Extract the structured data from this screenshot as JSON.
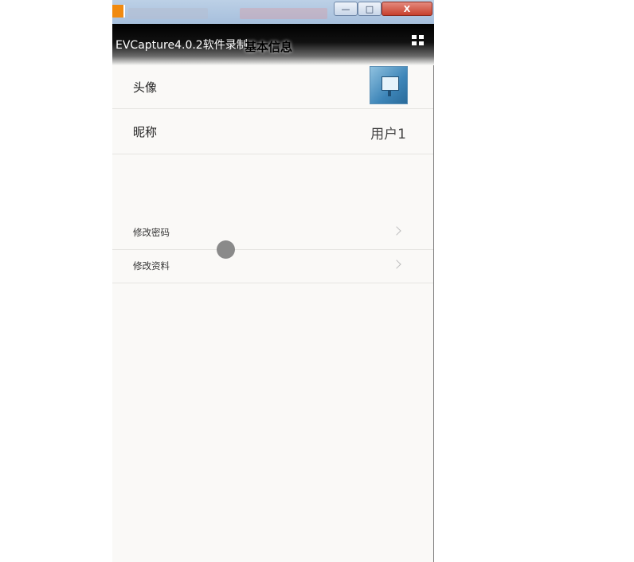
{
  "window": {
    "recorder_title": "EVCapture4.0.2软件录制",
    "buttons": {
      "minimize": "—",
      "maximize": "□",
      "close": "X"
    }
  },
  "header": {
    "title": "基本信息",
    "menu_icon": "grid-icon"
  },
  "profile": {
    "avatar_label": "头像",
    "nickname_label": "昵称",
    "nickname_value": "用户1"
  },
  "actions": [
    {
      "label": "修改密码",
      "icon": "chevron-right-icon"
    },
    {
      "label": "修改资料",
      "icon": "chevron-right-icon"
    }
  ],
  "colors": {
    "header_bg": "#000000",
    "panel_bg": "#faf9f7",
    "close_button": "#c8412e"
  }
}
